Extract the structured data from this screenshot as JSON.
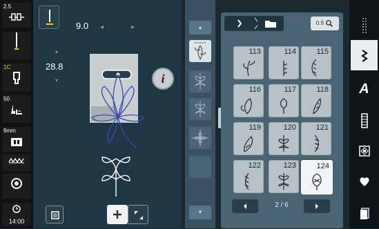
{
  "left_sidebar": {
    "upper_thread_tension": "2.5",
    "presser_foot_label": "1C",
    "presser_pressure": "50",
    "stitch_width_label": "9mm",
    "clock": "14:00"
  },
  "stitch_settings": {
    "length_value": "9.0",
    "width_value": "28.8"
  },
  "pattern_panel": {
    "tabs": [
      "stitch-pattern-tab",
      "folder-tab"
    ],
    "zoom_label": "0.9",
    "patterns": [
      {
        "number": "113"
      },
      {
        "number": "114"
      },
      {
        "number": "115"
      },
      {
        "number": "116"
      },
      {
        "number": "117"
      },
      {
        "number": "118"
      },
      {
        "number": "119"
      },
      {
        "number": "120"
      },
      {
        "number": "121"
      },
      {
        "number": "122"
      },
      {
        "number": "123"
      },
      {
        "number": "124"
      }
    ],
    "selected_pattern": "124",
    "page_indicator": "2 / 6"
  },
  "colors": {
    "background": "#1c2a32",
    "selected": "#f2f4f5",
    "accent_yellow": "#e8d800"
  }
}
